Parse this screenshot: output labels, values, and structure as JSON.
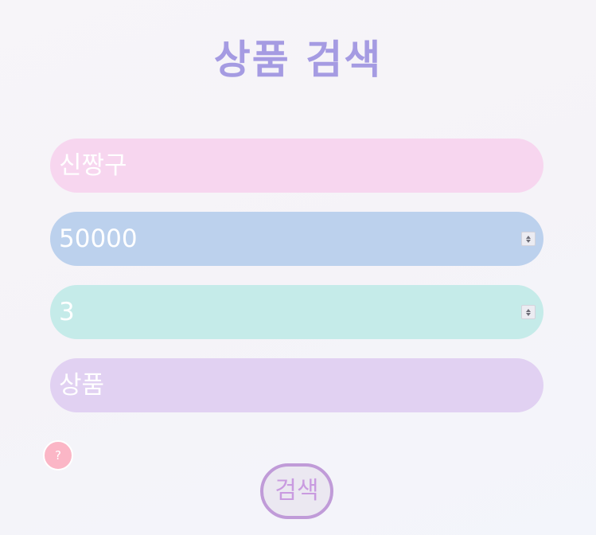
{
  "page": {
    "title": "상품 검색"
  },
  "form": {
    "product_name": {
      "value": "신짱구"
    },
    "max_price": {
      "value": "50000"
    },
    "quantity": {
      "value": "3"
    },
    "category": {
      "value": "상품"
    }
  },
  "help_button": {
    "label": "?"
  },
  "search_button": {
    "label": "검색"
  },
  "colors": {
    "title": "#a59be2",
    "name_field": "#f7d6ef",
    "price_field": "#bcd1ed",
    "quantity_field": "#c5ebe9",
    "category_field": "#e1d1f2",
    "help_button": "#fbb6c6",
    "search_button_border": "#c09bd8",
    "search_button_text": "#c99be0"
  },
  "icons": {
    "spinner": "number-stepper-icon"
  }
}
